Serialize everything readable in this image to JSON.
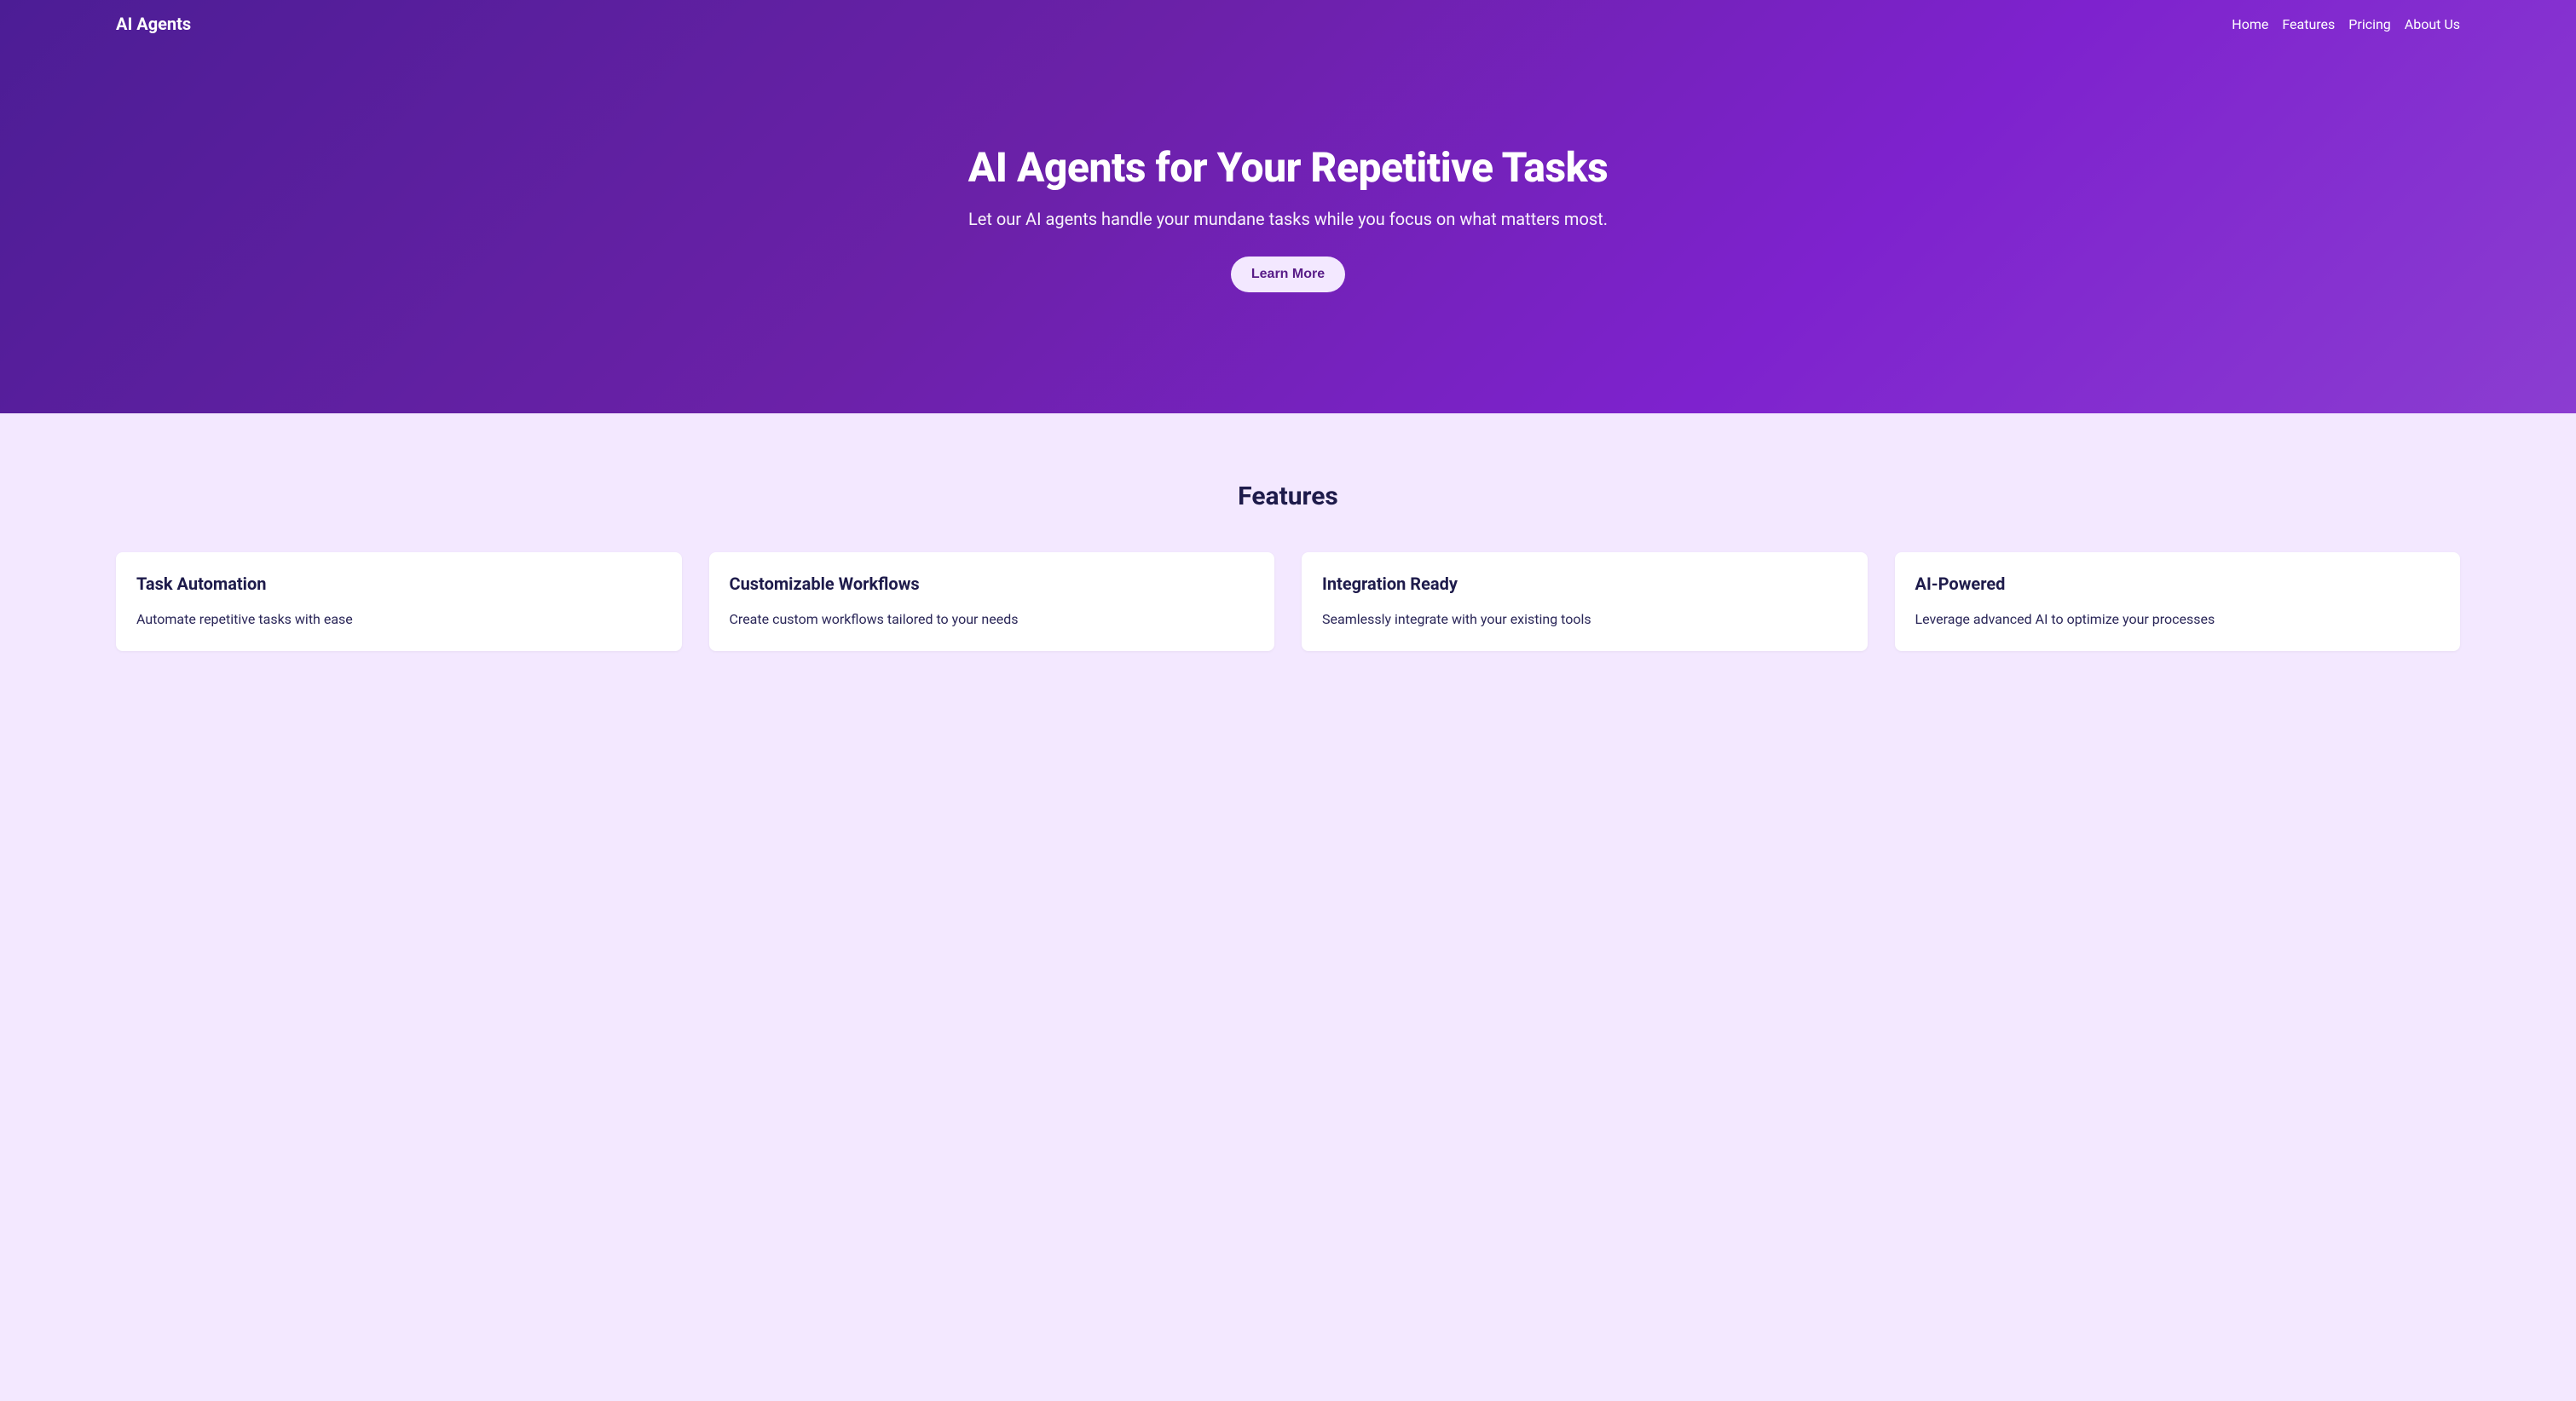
{
  "brand": "AI Agents",
  "nav": {
    "links": [
      {
        "label": "Home"
      },
      {
        "label": "Features"
      },
      {
        "label": "Pricing"
      },
      {
        "label": "About Us"
      }
    ]
  },
  "hero": {
    "title": "AI Agents for Your Repetitive Tasks",
    "subtitle": "Let our AI agents handle your mundane tasks while you focus on what matters most.",
    "cta_label": "Learn More"
  },
  "features": {
    "heading": "Features",
    "items": [
      {
        "title": "Task Automation",
        "description": "Automate repetitive tasks with ease"
      },
      {
        "title": "Customizable Workflows",
        "description": "Create custom workflows tailored to your needs"
      },
      {
        "title": "Integration Ready",
        "description": "Seamlessly integrate with your existing tools"
      },
      {
        "title": "AI-Powered",
        "description": "Leverage advanced AI to optimize your processes"
      }
    ]
  }
}
